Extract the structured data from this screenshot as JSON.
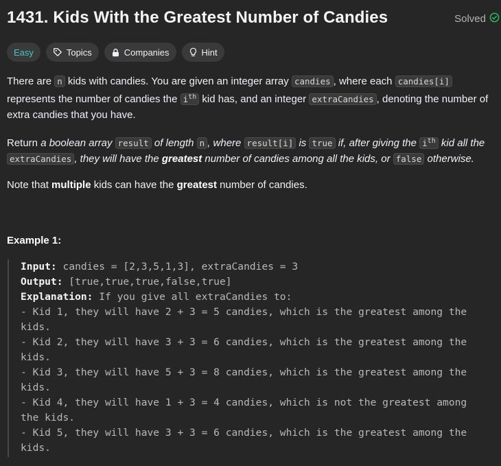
{
  "problem": {
    "title": "1431. Kids With the Greatest Number of Candies",
    "status": "Solved"
  },
  "tags": {
    "difficulty": "Easy",
    "topics": "Topics",
    "companies": "Companies",
    "hint": "Hint"
  },
  "description": {
    "p1": {
      "t1": "There are ",
      "c1": "n",
      "t2": " kids with candies. You are given an integer array ",
      "c2": "candies",
      "t3": ", where each ",
      "c3": "candies[i]",
      "t4": " represents the number of candies the ",
      "c4": "i",
      "c4sup": "th",
      "t5": " kid has, and an integer ",
      "c5": "extraCandies",
      "t6": ", denoting the number of extra candies that you have."
    },
    "p2": {
      "t1": "Return ",
      "i1": "a boolean array ",
      "c1": "result",
      "i2": " of length ",
      "c2": "n",
      "i3": ", where ",
      "c3": "result[i]",
      "i4": " is ",
      "c4": "true",
      "i5": " if, after giving the ",
      "c5": "i",
      "c5sup": "th",
      "i6": " kid all the ",
      "c6": "extraCandies",
      "i7": ", they will have the ",
      "b1": "greatest",
      "i8": " number of candies among all the kids, or ",
      "c7": "false",
      "i9": " otherwise."
    },
    "p3": {
      "t1": "Note that ",
      "b1": "multiple",
      "t2": " kids can have the ",
      "b2": "greatest",
      "t3": " number of candies."
    }
  },
  "example": {
    "title": "Example 1:",
    "input_label": "Input:",
    "input_value": " candies = [2,3,5,1,3], extraCandies = 3",
    "output_label": "Output:",
    "output_value": " [true,true,true,false,true]",
    "explanation_label": "Explanation:",
    "explanation_value": " If you give all extraCandies to:",
    "lines": [
      "- Kid 1, they will have 2 + 3 = 5 candies, which is the greatest among the",
      "kids.",
      "- Kid 2, they will have 3 + 3 = 6 candies, which is the greatest among the",
      "kids.",
      "- Kid 3, they will have 5 + 3 = 8 candies, which is the greatest among the",
      "kids.",
      "- Kid 4, they will have 1 + 3 = 4 candies, which is not the greatest among",
      "the kids.",
      "- Kid 5, they will have 3 + 3 = 6 candies, which is the greatest among the",
      "kids."
    ]
  },
  "colors": {
    "background": "#262626",
    "easy": "#46c6c2",
    "solved_check": "#2cbb5d",
    "tag_bg": "#3a3a3a"
  },
  "icons": {
    "solved": "check-circle-icon",
    "topics": "tag-icon",
    "companies": "lock-icon",
    "hint": "lightbulb-icon"
  }
}
